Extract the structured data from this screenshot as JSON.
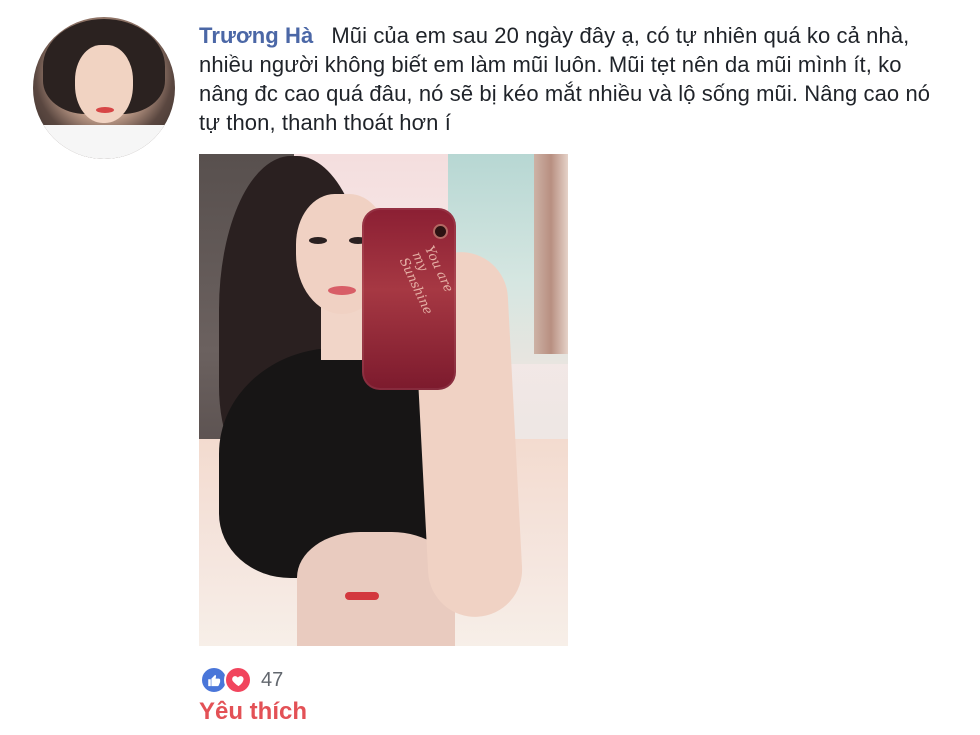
{
  "comment": {
    "author": "Trương Hà",
    "text": "Mũi của em sau 20 ngày đây ạ, có tự nhiên quá ko cả nhà, nhiều người không biết em làm mũi luôn. Mũi tẹt nên da mũi mình ít, ko nâng đc cao quá đâu, nó sẽ bị kéo mắt nhiều và lộ sống mũi. Nâng cao nó tự thon, thanh thoát hơn í"
  },
  "photo": {
    "phone_case_text": "You are my Sunshine"
  },
  "reactions": {
    "count": "47",
    "icons": [
      "like-icon",
      "heart-icon"
    ]
  },
  "action": {
    "label": "Yêu thích"
  },
  "colors": {
    "author": "#4b67a6",
    "like": "#4a76d9",
    "love": "#f1455d",
    "action": "#e35156"
  }
}
